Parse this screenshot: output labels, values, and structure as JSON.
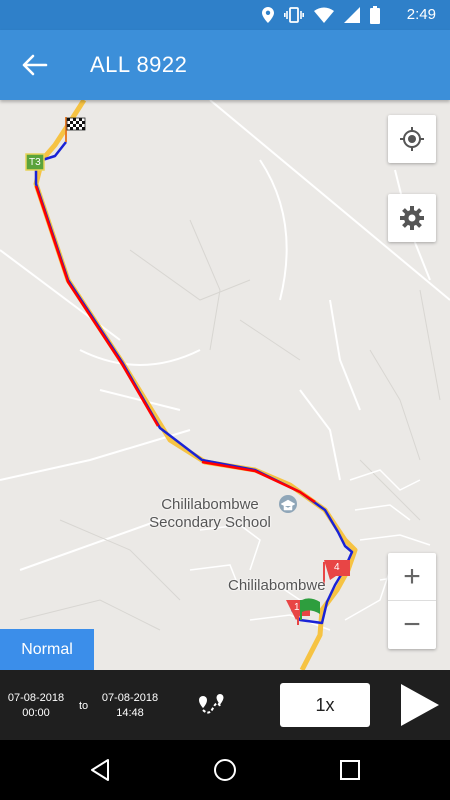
{
  "status_bar": {
    "time": "2:49",
    "icons": [
      "location-icon",
      "vibrate-icon",
      "wifi-icon",
      "signal-icon",
      "battery-icon"
    ]
  },
  "app_bar": {
    "title": "ALL 8922",
    "back_icon": "arrow-back-icon"
  },
  "map": {
    "labels": {
      "school": "Chililabombwe\nSecondary School",
      "town": "Chililabombwe",
      "road_marker": "T3"
    },
    "markers": [
      {
        "name": "start-marker",
        "label": "1",
        "color": "#e84545"
      },
      {
        "name": "stop-marker",
        "label": "4",
        "color": "#e84545"
      },
      {
        "name": "green-flag",
        "label": "",
        "color": "#2e9e3e"
      },
      {
        "name": "finish-flag",
        "label": "",
        "color": "#000000"
      }
    ],
    "route_colors": {
      "speeding": "#ff0000",
      "normal": "#1a23d6",
      "road": "#f6c343"
    },
    "buttons": [
      "my-location-icon",
      "gear-icon"
    ],
    "zoom": {
      "in": "+",
      "out": "−"
    },
    "map_type": "Normal"
  },
  "controls": {
    "from_date": "07-08-2018",
    "from_time": "00:00",
    "to_label": "to",
    "to_date": "07-08-2018",
    "to_time": "14:48",
    "route_icon": "route-icon",
    "speed": "1x",
    "play_icon": "play-icon"
  },
  "nav_bar": [
    "back-triangle-icon",
    "home-circle-icon",
    "recents-square-icon"
  ]
}
